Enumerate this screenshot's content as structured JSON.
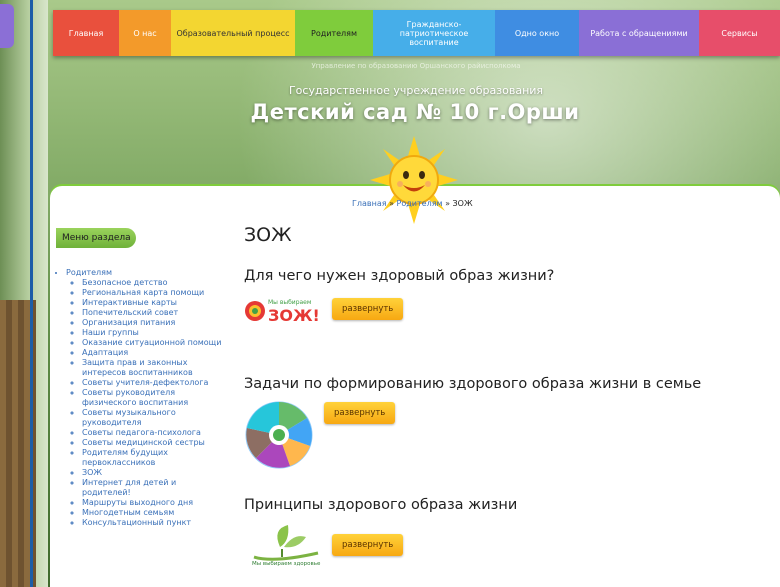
{
  "nav": [
    {
      "label": "Главная"
    },
    {
      "label": "О нас"
    },
    {
      "label": "Образовательный процесс"
    },
    {
      "label": "Родителям"
    },
    {
      "label": "Гражданско-патриотическое воспитание"
    },
    {
      "label": "Одно окно"
    },
    {
      "label": "Работа с обращениями"
    },
    {
      "label": "Сервисы"
    }
  ],
  "header": {
    "sub": "Управление по образованию Оршанского райисполкома",
    "org": "Государственное учреждение образования",
    "title": "Детский сад № 10 г.Орши"
  },
  "breadcrumb": {
    "home": "Главная",
    "sep1": " » ",
    "middle": "Родителям",
    "sep2": " » ",
    "current": "ЗОЖ"
  },
  "menu": {
    "title": "Меню раздела",
    "parent": "Родителям",
    "items": [
      "Безопасное детство",
      "Региональная карта помощи",
      "Интерактивные карты",
      "Попечительский совет",
      "Организация питания",
      "Наши группы",
      "Оказание ситуационной помощи",
      "Адаптация",
      "Защита прав и законных интересов воспитанников",
      "Советы учителя-дефектолога",
      "Советы руководителя физического воспитания",
      "Советы музыкального руководителя",
      "Советы педагога-психолога",
      "Советы медицинской сестры",
      "Родителям будущих первоклассников",
      "ЗОЖ",
      "Интернет для детей и родителей!",
      "Маршруты выходного дня",
      "Многодетным семьям",
      "Консультационный пункт"
    ]
  },
  "page": {
    "title": "ЗОЖ",
    "sections": [
      {
        "heading": "Для чего нужен здоровый образ жизни?",
        "button": "развернуть",
        "image_text_small": "Мы выбираем",
        "image_text_big": "ЗОЖ!"
      },
      {
        "heading": "Задачи по формированию здорового образа жизни в семье",
        "button": "развернуть"
      },
      {
        "heading": "Принципы здорового образа жизни",
        "button": "развернуть",
        "image_text": "Мы выбираем здоровье"
      }
    ]
  },
  "icons": {
    "sun": "sun-mascot-icon"
  },
  "colors": {
    "link": "#3a70b8",
    "button": "#f7a812",
    "menu_green": "#7fcc3c"
  }
}
